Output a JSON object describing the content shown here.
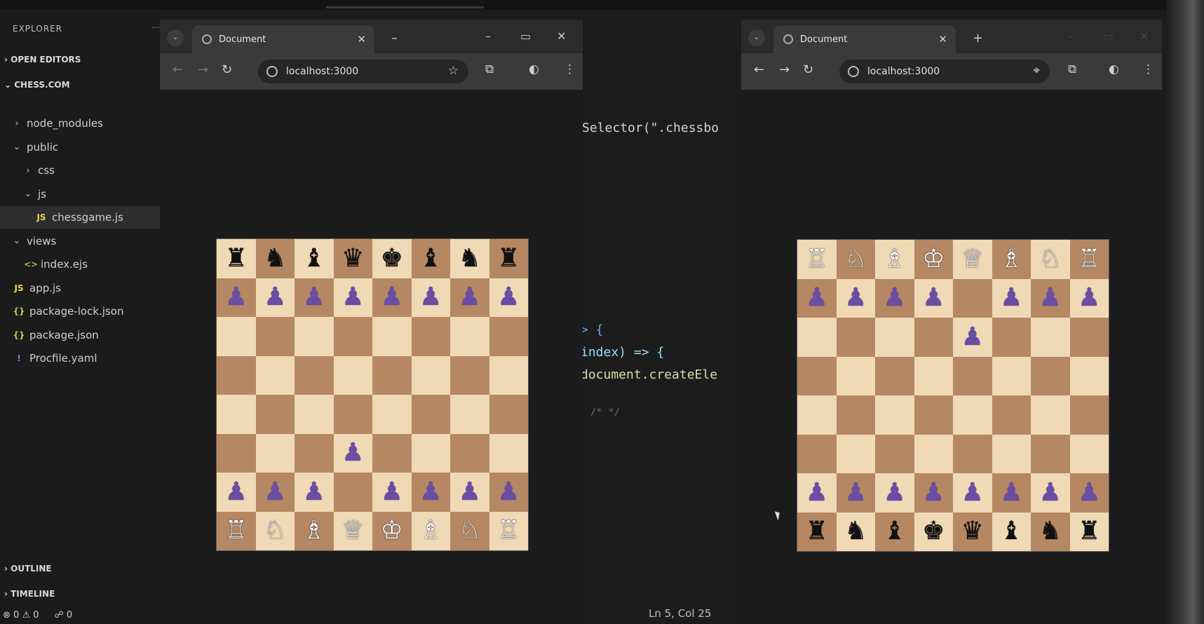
{
  "sidebar": {
    "title": "EXPLORER",
    "sections": {
      "open_editors": "OPEN EDITORS",
      "project": "CHESS.COM",
      "outline": "OUTLINE",
      "timeline": "TIMELINE"
    },
    "tree": [
      {
        "label": "node_modules",
        "icon": "chevron-right-icon",
        "indent": 1,
        "type": "folder"
      },
      {
        "label": "public",
        "icon": "chevron-down-icon",
        "indent": 1,
        "type": "folder"
      },
      {
        "label": "css",
        "icon": "chevron-right-icon",
        "indent": 2,
        "type": "folder"
      },
      {
        "label": "js",
        "icon": "chevron-down-icon",
        "indent": 2,
        "type": "folder"
      },
      {
        "label": "chessgame.js",
        "icon": "js-file-icon",
        "indent": 3,
        "type": "file",
        "active": true
      },
      {
        "label": "views",
        "icon": "chevron-down-icon",
        "indent": 1,
        "type": "folder"
      },
      {
        "label": "index.ejs",
        "icon": "ejs-file-icon",
        "indent": 2,
        "type": "file"
      },
      {
        "label": "app.js",
        "icon": "js-file-icon",
        "indent": 1,
        "type": "file"
      },
      {
        "label": "package-lock.json",
        "icon": "json-file-icon",
        "indent": 1,
        "type": "file"
      },
      {
        "label": "package.json",
        "icon": "json-file-icon",
        "indent": 1,
        "type": "file"
      },
      {
        "label": "Procfile.yaml",
        "icon": "yaml-file-icon",
        "indent": 1,
        "type": "file"
      }
    ],
    "status": {
      "errors": "0",
      "warnings": "0",
      "ports": "0"
    }
  },
  "editor": {
    "code_lines": [
      "Selector(\".chessbo",
      "> {",
      "index) => {",
      "document.createEle",
      "/* */"
    ],
    "status_position": "Ln 5, Col 25"
  },
  "browser_left": {
    "tab_title": "Document",
    "url": "localhost:3000"
  },
  "browser_right": {
    "tab_title": "Document",
    "url": "localhost:3000"
  },
  "board_left": {
    "orientation": "white",
    "rows": [
      [
        "r",
        "n",
        "b",
        "q",
        "k",
        "b",
        "n",
        "r"
      ],
      [
        "p",
        "p",
        "p",
        "p",
        "p",
        "p",
        "p",
        "p"
      ],
      [
        "",
        "",
        "",
        "",
        "",
        "",
        "",
        ""
      ],
      [
        "",
        "",
        "",
        "",
        "",
        "",
        "",
        ""
      ],
      [
        "",
        "",
        "",
        "",
        "",
        "",
        "",
        ""
      ],
      [
        "",
        "",
        "",
        "P",
        "",
        "",
        "",
        ""
      ],
      [
        "P",
        "P",
        "P",
        "",
        "P",
        "P",
        "P",
        "P"
      ],
      [
        "R",
        "N",
        "B",
        "Q",
        "K",
        "B",
        "N",
        "R"
      ]
    ]
  },
  "board_right": {
    "orientation": "black",
    "rows": [
      [
        "R",
        "N",
        "B",
        "K",
        "Q",
        "B",
        "N",
        "R"
      ],
      [
        "p",
        "p",
        "p",
        "p",
        "",
        "p",
        "p",
        "p"
      ],
      [
        "",
        "",
        "",
        "",
        "p",
        "",
        "",
        ""
      ],
      [
        "",
        "",
        "",
        "",
        "",
        "",
        "",
        ""
      ],
      [
        "",
        "",
        "",
        "",
        "",
        "",
        "",
        ""
      ],
      [
        "",
        "",
        "",
        "",
        "",
        "",
        "",
        ""
      ],
      [
        "P",
        "P",
        "P",
        "P",
        "P",
        "P",
        "P",
        "P"
      ],
      [
        "r",
        "n",
        "b",
        "k",
        "q",
        "b",
        "n",
        "r"
      ]
    ]
  },
  "pieces": {
    "k": "♚",
    "q": "♛",
    "r": "♜",
    "b": "♝",
    "n": "♞",
    "p": "♟",
    "K": "♔",
    "Q": "♕",
    "R": "♖",
    "B": "♗",
    "N": "♘",
    "P": "♟"
  }
}
